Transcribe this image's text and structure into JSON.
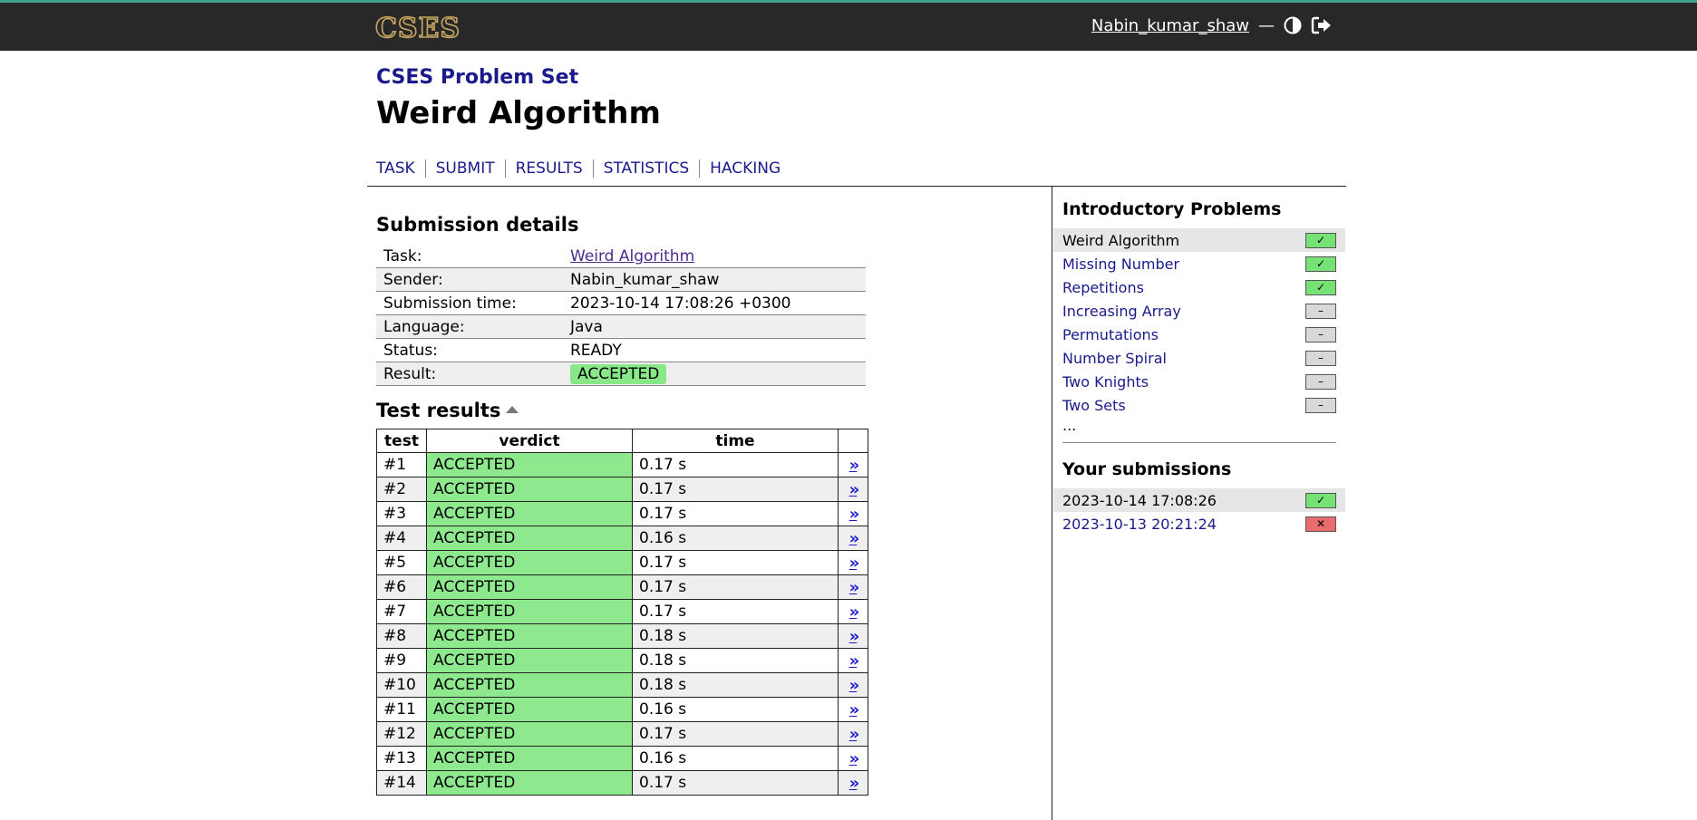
{
  "header": {
    "logo_text": "CSES",
    "username": "Nabin_kumar_shaw",
    "separator": "—",
    "icons": [
      "theme-toggle-icon",
      "logout-icon"
    ]
  },
  "problemset": {
    "title": "CSES Problem Set"
  },
  "page": {
    "title": "Weird Algorithm"
  },
  "nav": {
    "tabs": [
      {
        "label": "TASK"
      },
      {
        "label": "SUBMIT"
      },
      {
        "label": "RESULTS"
      },
      {
        "label": "STATISTICS"
      },
      {
        "label": "HACKING"
      }
    ]
  },
  "submission": {
    "heading": "Submission details",
    "rows": [
      {
        "label": "Task:",
        "value": "Weird Algorithm"
      },
      {
        "label": "Sender:",
        "value": "Nabin_kumar_shaw"
      },
      {
        "label": "Submission time:",
        "value": "2023-10-14 17:08:26 +0300"
      },
      {
        "label": "Language:",
        "value": "Java"
      },
      {
        "label": "Status:",
        "value": "READY"
      },
      {
        "label": "Result:",
        "value": "ACCEPTED"
      }
    ]
  },
  "tests": {
    "heading": "Test results",
    "columns": [
      "test",
      "verdict",
      "time",
      ""
    ],
    "view_glyph": "»",
    "rows": [
      {
        "test": "#1",
        "verdict": "ACCEPTED",
        "time": "0.17 s"
      },
      {
        "test": "#2",
        "verdict": "ACCEPTED",
        "time": "0.17 s"
      },
      {
        "test": "#3",
        "verdict": "ACCEPTED",
        "time": "0.17 s"
      },
      {
        "test": "#4",
        "verdict": "ACCEPTED",
        "time": "0.16 s"
      },
      {
        "test": "#5",
        "verdict": "ACCEPTED",
        "time": "0.17 s"
      },
      {
        "test": "#6",
        "verdict": "ACCEPTED",
        "time": "0.17 s"
      },
      {
        "test": "#7",
        "verdict": "ACCEPTED",
        "time": "0.17 s"
      },
      {
        "test": "#8",
        "verdict": "ACCEPTED",
        "time": "0.18 s"
      },
      {
        "test": "#9",
        "verdict": "ACCEPTED",
        "time": "0.18 s"
      },
      {
        "test": "#10",
        "verdict": "ACCEPTED",
        "time": "0.18 s"
      },
      {
        "test": "#11",
        "verdict": "ACCEPTED",
        "time": "0.16 s"
      },
      {
        "test": "#12",
        "verdict": "ACCEPTED",
        "time": "0.17 s"
      },
      {
        "test": "#13",
        "verdict": "ACCEPTED",
        "time": "0.16 s"
      },
      {
        "test": "#14",
        "verdict": "ACCEPTED",
        "time": "0.17 s"
      }
    ]
  },
  "sidebar": {
    "problems_heading": "Introductory Problems",
    "problems": [
      {
        "name": "Weird Algorithm",
        "status": "solved",
        "glyph": "✓"
      },
      {
        "name": "Missing Number",
        "status": "solved",
        "glyph": "✓"
      },
      {
        "name": "Repetitions",
        "status": "solved",
        "glyph": "✓"
      },
      {
        "name": "Increasing Array",
        "status": "none",
        "glyph": "–"
      },
      {
        "name": "Permutations",
        "status": "none",
        "glyph": "–"
      },
      {
        "name": "Number Spiral",
        "status": "none",
        "glyph": "–"
      },
      {
        "name": "Two Knights",
        "status": "none",
        "glyph": "–"
      },
      {
        "name": "Two Sets",
        "status": "none",
        "glyph": "–"
      }
    ],
    "more": "...",
    "submissions_heading": "Your submissions",
    "submissions": [
      {
        "time": "2023-10-14 17:08:26",
        "status": "accepted",
        "glyph": "✓"
      },
      {
        "time": "2023-10-13 20:21:24",
        "status": "failed",
        "glyph": "✕"
      }
    ]
  },
  "colors": {
    "topbar": "#282828",
    "accent_line": "#3fa58a",
    "link": "#1a1a8c",
    "accepted": "#8ee888",
    "failed": "#e86c6c"
  }
}
